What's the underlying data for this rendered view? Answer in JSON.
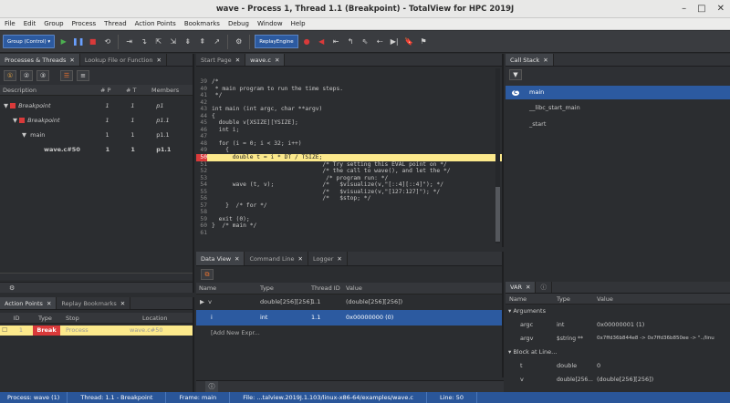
{
  "window": {
    "title": "wave - Process 1, Thread 1.1 (Breakpoint) - TotalView for HPC 2019J",
    "min": "–",
    "max": "□",
    "close": "✕"
  },
  "menu": [
    "File",
    "Edit",
    "Group",
    "Process",
    "Thread",
    "Action Points",
    "Bookmarks",
    "Debug",
    "Window",
    "Help"
  ],
  "toolbar": {
    "group_select": "Group (Control)",
    "replay_engine": "ReplayEngine"
  },
  "left_tabs": {
    "processes_threads": "Processes & Threads",
    "lookup": "Lookup File or Function",
    "close": "✕"
  },
  "proc_headers": {
    "description": "Description",
    "p": "# P",
    "t": "# T",
    "members": "Members"
  },
  "proc_rows": [
    {
      "label": "Breakpoint",
      "p": "1",
      "t": "1",
      "members": "p1",
      "bold": false,
      "italic": true
    },
    {
      "label": "Breakpoint",
      "p": "1",
      "t": "1",
      "members": "p1.1",
      "bold": false,
      "italic": true
    },
    {
      "label": "main",
      "p": "1",
      "t": "1",
      "members": "p1.1",
      "bold": false,
      "italic": false
    },
    {
      "label": "wave.c#50",
      "p": "1",
      "t": "1",
      "members": "p1.1",
      "bold": true,
      "italic": false
    }
  ],
  "ap_tabs": {
    "action_points": "Action Points",
    "replay_bookmarks": "Replay Bookmarks",
    "close": "✕"
  },
  "ap_headers": {
    "id": "ID",
    "type": "Type",
    "stop": "Stop",
    "location": "Location"
  },
  "ap_row": {
    "id": "1",
    "type": "Break",
    "stop": "Process",
    "location": "wave.c#50"
  },
  "source_tabs": {
    "start_page": "Start Page",
    "file": "wave.c",
    "close": "✕"
  },
  "code_lines": [
    {
      "n": "39",
      "text": "/*"
    },
    {
      "n": "40",
      "text": " * main program to run the time steps."
    },
    {
      "n": "41",
      "text": " */"
    },
    {
      "n": "42",
      "text": ""
    },
    {
      "n": "43",
      "text": "int main (int argc, char **argv)"
    },
    {
      "n": "44",
      "text": "{"
    },
    {
      "n": "45",
      "text": "  double v[XSIZE][YSIZE];"
    },
    {
      "n": "46",
      "text": "  int i;"
    },
    {
      "n": "47",
      "text": ""
    },
    {
      "n": "48",
      "text": "  for (i = 0; i < 32; i++)"
    },
    {
      "n": "49",
      "text": "    {"
    },
    {
      "n": "50",
      "text": "      double t = i * DT / TSIZE;"
    },
    {
      "n": "51",
      "text": "                                /* Try setting this EVAL point on */"
    },
    {
      "n": "52",
      "text": "                                /* the call to wave(), and let the */"
    },
    {
      "n": "53",
      "text": "                                 /* program run: */"
    },
    {
      "n": "54",
      "text": "      wave (t, v);              /*   $visualize(v,\"[::4][::4]\"); */"
    },
    {
      "n": "55",
      "text": "                                /*   $visualize(v,\"[127:127]\"); */"
    },
    {
      "n": "56",
      "text": "                                /*   $stop; */"
    },
    {
      "n": "57",
      "text": "    }  /* for */"
    },
    {
      "n": "58",
      "text": ""
    },
    {
      "n": "59",
      "text": "  exit (0);"
    },
    {
      "n": "60",
      "text": "}  /* main */"
    },
    {
      "n": "61",
      "text": ""
    }
  ],
  "current_line": "50",
  "data_tabs": {
    "data_view": "Data View",
    "command_line": "Command Line",
    "logger": "Logger",
    "close": "✕"
  },
  "data_headers": {
    "name": "Name",
    "type": "Type",
    "thread": "Thread ID",
    "value": "Value"
  },
  "data_rows": [
    {
      "name": "v",
      "type": "double[256][256]",
      "thread": "1.1",
      "value": "(double[256][256])"
    },
    {
      "name": "i",
      "type": "int",
      "thread": "1.1",
      "value": "0x00000000 (0)"
    }
  ],
  "add_expr": "[Add New Expr...",
  "call_stack": {
    "tab": "Call Stack",
    "close": "✕",
    "frames": [
      "main",
      "__libc_start_main",
      "_start"
    ],
    "lang": "C"
  },
  "var": {
    "tab": "VAR",
    "close": "✕",
    "headers": {
      "name": "Name",
      "type": "Type",
      "value": "Value"
    },
    "arguments_label": "Arguments",
    "args": [
      {
        "name": "argc",
        "type": "int",
        "value": "0x00000001 (1)"
      },
      {
        "name": "argv",
        "type": "$string **",
        "value": "0x7ffd36b844e8 -> 0x7ffd36b850ee -> \"../linu"
      }
    ],
    "block_label": "Block at Line...",
    "locals": [
      {
        "name": "t",
        "type": "double",
        "value": "0"
      },
      {
        "name": "v",
        "type": "double[256...",
        "value": "(double[256][256])"
      }
    ]
  },
  "status": {
    "process": "Process: wave (1)",
    "thread": "Thread: 1.1 - Breakpoint",
    "frame": "Frame: main",
    "file": "File: ...talview.2019J.1.103/linux-x86-64/examples/wave.c",
    "line": "Line: 50"
  }
}
